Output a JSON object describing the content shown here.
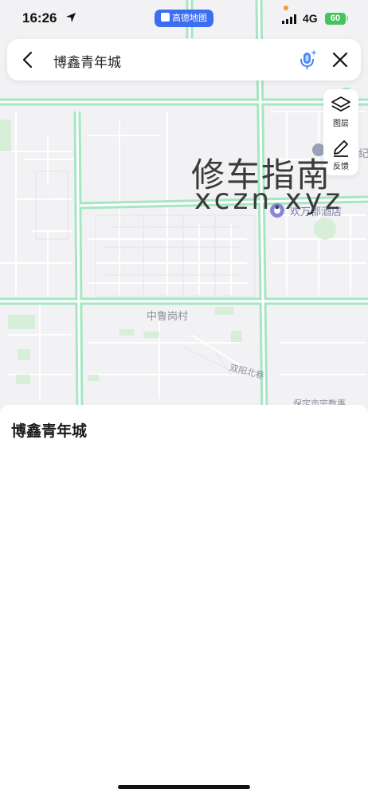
{
  "status_bar": {
    "time": "16:26",
    "app_name": "高德地图",
    "network": "4G",
    "battery": "60"
  },
  "search": {
    "query": "博鑫青年城"
  },
  "tools": {
    "layers_label": "图层",
    "feedback_label": "反馈"
  },
  "map": {
    "village_label": "中鲁岗村",
    "road_label": "双阳北巷",
    "hotel_label": "欢万郡酒店",
    "edge_label": "纪",
    "bottom_label": "保定市宗教事"
  },
  "watermark": {
    "title": "修车指南",
    "url": "xczn.xyz"
  },
  "sheet": {
    "title": "博鑫青年城"
  },
  "colors": {
    "road_green": "#a6e6c2",
    "map_bg": "#f2f2f4",
    "accent_blue": "#3b6ef0",
    "battery_green": "#45c45a"
  }
}
